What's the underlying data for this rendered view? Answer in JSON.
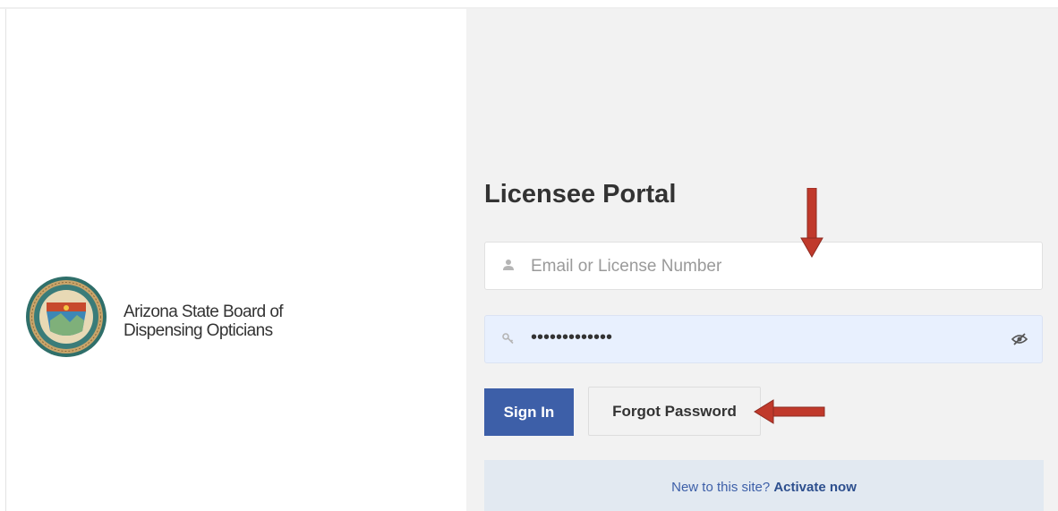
{
  "organization": {
    "line1": "Arizona State Board of",
    "line2": "Dispensing Opticians",
    "logo_icon": "arizona-state-seal-icon"
  },
  "portal": {
    "title": "Licensee Portal"
  },
  "login_form": {
    "email_placeholder": "Email or License Number",
    "email_icon": "user-icon",
    "password_value": "•••••••••••••",
    "password_icon": "key-icon",
    "password_toggle_icon": "eye-slash-icon",
    "sign_in_label": "Sign In",
    "forgot_password_label": "Forgot Password"
  },
  "activate": {
    "prompt": "New to this site?",
    "link": "Activate now"
  },
  "colors": {
    "primary": "#3d5fa8",
    "annotation_arrow": "#c0392b",
    "right_panel_bg": "#f2f2f2",
    "password_field_bg": "#e8f0fe"
  },
  "annotations": [
    {
      "type": "arrow",
      "direction": "down",
      "points_to": "email-field"
    },
    {
      "type": "arrow",
      "direction": "left",
      "points_to": "forgot-password-button"
    }
  ]
}
